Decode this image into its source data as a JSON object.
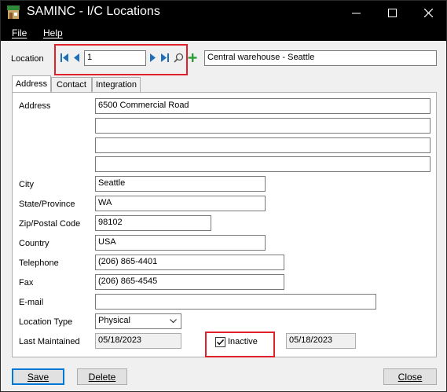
{
  "window": {
    "title": "SAMINC - I/C Locations",
    "minimize_glyph": "—",
    "maximize_glyph": "☐",
    "close_glyph": "✕"
  },
  "menu": {
    "file": "File",
    "help": "Help"
  },
  "location": {
    "label": "Location",
    "code": "1",
    "description": "Central warehouse - Seattle"
  },
  "tabs": [
    {
      "label": "Address"
    },
    {
      "label": "Contact"
    },
    {
      "label": "Integration"
    }
  ],
  "address": {
    "labels": {
      "address": "Address",
      "city": "City",
      "state": "State/Province",
      "zip": "Zip/Postal Code",
      "country": "Country",
      "telephone": "Telephone",
      "fax": "Fax",
      "email": "E-mail",
      "location_type": "Location Type",
      "last_maintained": "Last Maintained"
    },
    "address_line1": "6500 Commercial Road",
    "address_line2": "",
    "address_line3": "",
    "address_line4": "",
    "city": "Seattle",
    "state": "WA",
    "zip": "98102",
    "country": "USA",
    "telephone": "(206) 865-4401",
    "fax": "(206) 865-4545",
    "email": "",
    "location_type": "Physical",
    "last_maintained": "05/18/2023",
    "inactive_label": "Inactive",
    "inactive_checked": true,
    "inactive_date": "05/18/2023"
  },
  "buttons": {
    "save": "Save",
    "delete": "Delete",
    "close": "Close"
  },
  "colors": {
    "titlebar": "#000000",
    "highlight_box": "#e0202a",
    "nav_blue": "#1e6fb8",
    "add_green": "#2e9e3a"
  }
}
